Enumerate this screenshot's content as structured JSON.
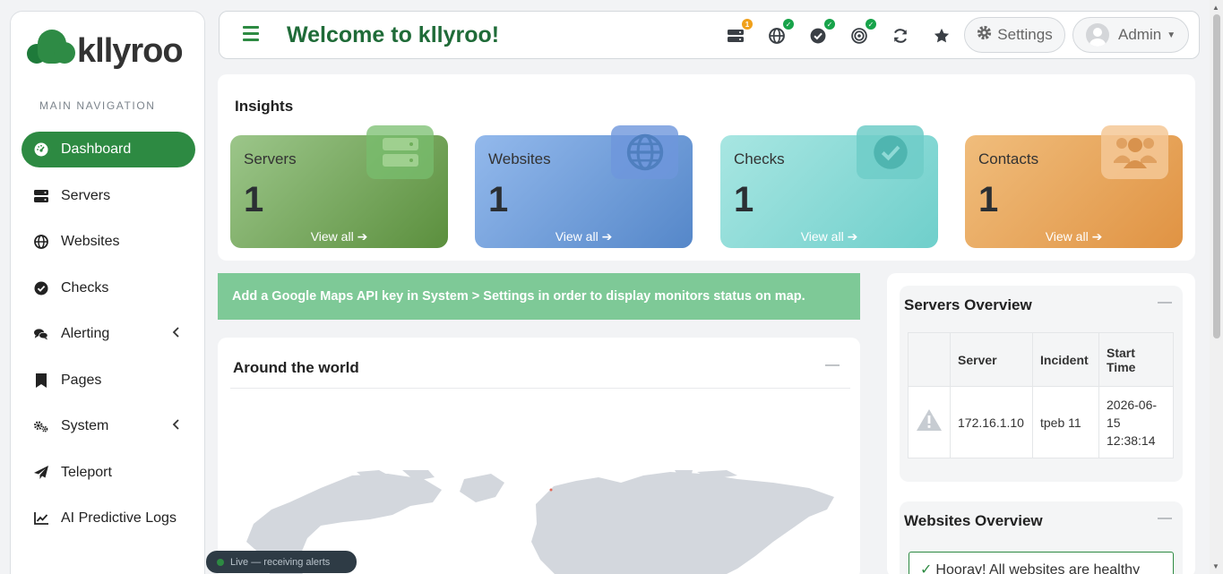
{
  "brand": {
    "name": "kllyroo",
    "color": "#2d8a42"
  },
  "sidebar": {
    "header": "MAIN NAVIGATION",
    "items": [
      {
        "label": "Dashboard",
        "icon": "gauge-icon",
        "active": true
      },
      {
        "label": "Servers",
        "icon": "server-icon"
      },
      {
        "label": "Websites",
        "icon": "globe-icon"
      },
      {
        "label": "Checks",
        "icon": "check-circle-icon"
      },
      {
        "label": "Alerting",
        "icon": "comments-icon",
        "has_submenu": true
      },
      {
        "label": "Pages",
        "icon": "bookmark-icon"
      },
      {
        "label": "System",
        "icon": "cogs-icon",
        "has_submenu": true
      },
      {
        "label": "Teleport",
        "icon": "paper-plane-icon"
      },
      {
        "label": "AI Predictive Logs",
        "icon": "chart-line-icon"
      }
    ]
  },
  "topbar": {
    "title": "Welcome to kllyroo!",
    "icons": [
      {
        "name": "servers-status-icon",
        "badge": "1"
      },
      {
        "name": "websites-status-icon",
        "badge": "✓"
      },
      {
        "name": "checks-status-icon",
        "badge": "✓"
      },
      {
        "name": "target-status-icon",
        "badge": "✓"
      },
      {
        "name": "refresh-icon"
      },
      {
        "name": "star-icon"
      }
    ],
    "settings_label": "Settings",
    "user_label": "Admin"
  },
  "insights": {
    "title": "Insights",
    "cards": [
      {
        "label": "Servers",
        "count": "1",
        "link": "View all"
      },
      {
        "label": "Websites",
        "count": "1",
        "link": "View all"
      },
      {
        "label": "Checks",
        "count": "1",
        "link": "View all"
      },
      {
        "label": "Contacts",
        "count": "1",
        "link": "View all"
      }
    ]
  },
  "alert_banner": "Add a Google Maps API key in System > Settings in order to display monitors status on map.",
  "world_panel": {
    "title": "Around the world"
  },
  "servers_overview": {
    "title": "Servers Overview",
    "columns": [
      "Server",
      "Incident",
      "Start Time"
    ],
    "rows": [
      {
        "server": "172.16.1.10",
        "incident": "tpeb 11",
        "start_time": "2026-06-15 12:38:14"
      }
    ]
  },
  "websites_overview": {
    "title": "Websites Overview",
    "message": "Hooray! All websites are healthy"
  },
  "live_status": "Live — receiving alerts"
}
